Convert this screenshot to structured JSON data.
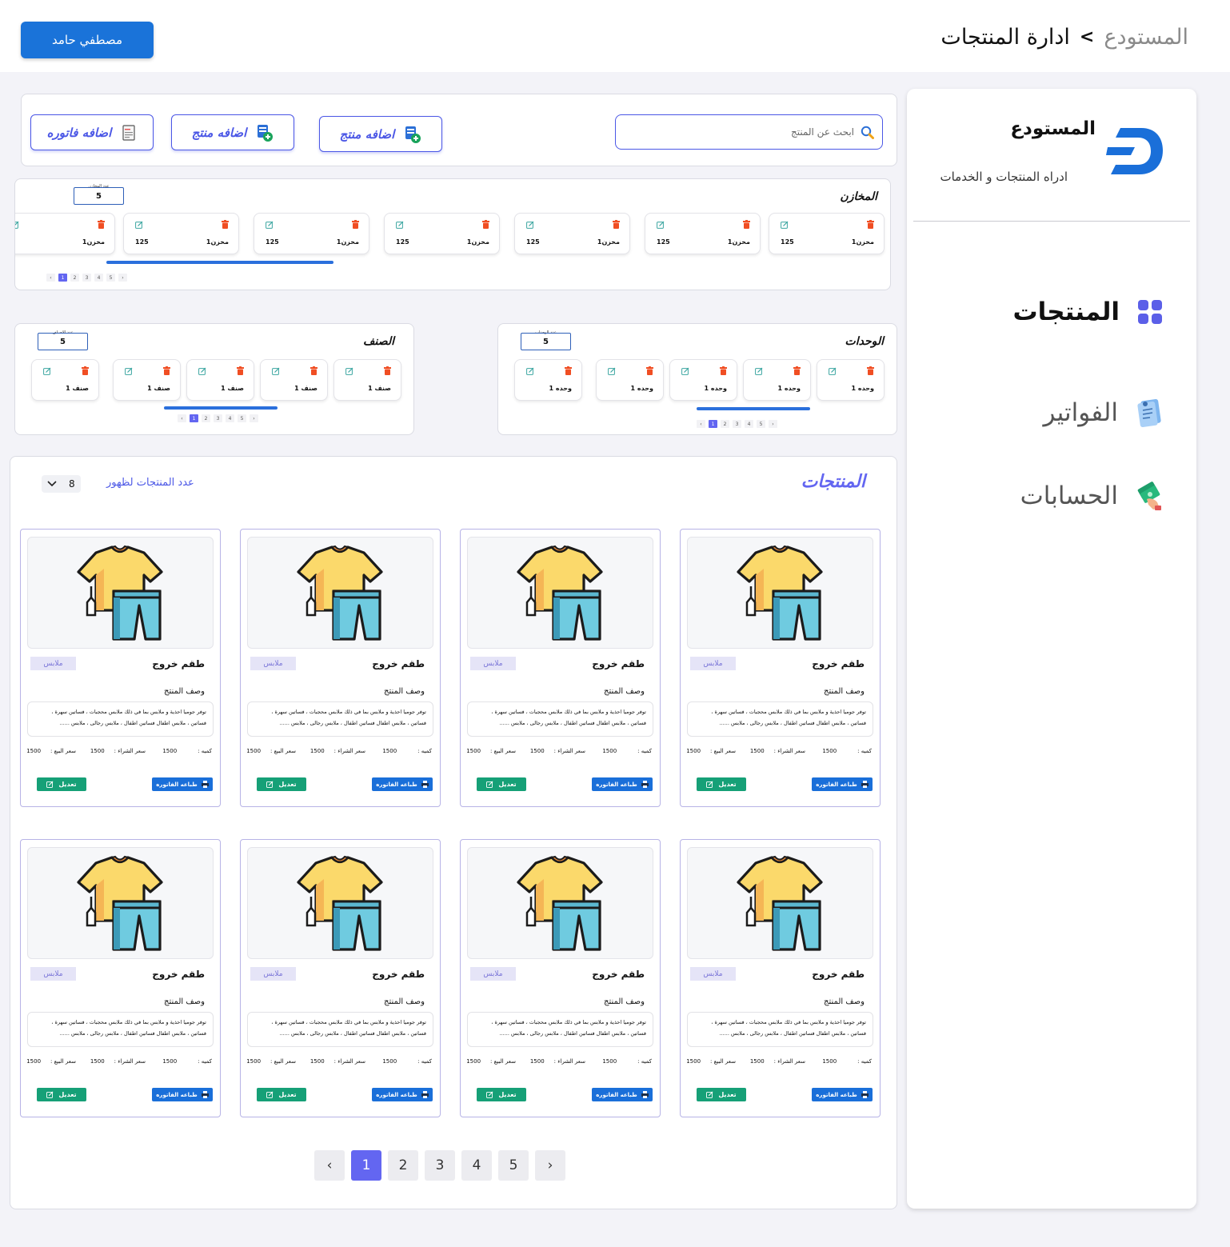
{
  "header": {
    "user_name": "مصطفي حامد",
    "breadcrumb_root": "المستودع",
    "breadcrumb_sep": ">",
    "breadcrumb_current": "ادارة المنتجات"
  },
  "sidebar": {
    "brand_title": "المستودع",
    "brand_subtitle": "ادراه المنتجات و الخدمات",
    "items": [
      {
        "label": "المنتجات",
        "icon": "grid-icon",
        "color": "#111111"
      },
      {
        "label": "الفواتير",
        "icon": "invoice-icon",
        "color": "#555555"
      },
      {
        "label": "الحسابات",
        "icon": "money-icon",
        "color": "#555555"
      }
    ]
  },
  "toolbar": {
    "search_placeholder": "ابحث عن المنتج",
    "buttons": [
      "اضافه منتج",
      "اضافه منتج",
      "اضافه فاتوره"
    ]
  },
  "warehouses": {
    "title": "المخازن",
    "count_label": "عدد المخازن",
    "count": "5",
    "items": [
      {
        "name": "مخزن1",
        "qty": "125"
      },
      {
        "name": "مخزن1",
        "qty": "125"
      },
      {
        "name": "مخزن1",
        "qty": "125"
      },
      {
        "name": "مخزن1",
        "qty": "125"
      },
      {
        "name": "مخزن1",
        "qty": "125"
      },
      {
        "name": "مخزن1",
        "qty": "125"
      },
      {
        "name": "مخزن1",
        "qty": ""
      }
    ],
    "pages": [
      "‹",
      "1",
      "2",
      "3",
      "4",
      "5",
      "›"
    ]
  },
  "units": {
    "title": "الوحدات",
    "count_label": "عدد الوحدات",
    "count": "5",
    "items": [
      "وحده 1",
      "وحده 1",
      "وحده 1",
      "وحده 1",
      "وحده 1"
    ],
    "pages": [
      "‹",
      "1",
      "2",
      "3",
      "4",
      "5",
      "›"
    ]
  },
  "categories": {
    "title": "الصنف",
    "count_label": "عدد الاصناف",
    "count": "5",
    "items": [
      "صنف 1",
      "صنف 1",
      "صنف 1",
      "صنف 1",
      "صنف 1"
    ],
    "pages": [
      "‹",
      "1",
      "2",
      "3",
      "4",
      "5",
      "›"
    ]
  },
  "products": {
    "title": "المنتجات",
    "per_page_label": "عدد المنتجات لظهور",
    "per_page": "8",
    "card": {
      "name": "طقم خروج",
      "tag": "ملابس",
      "desc_label": "وصف المنتج",
      "desc": "توفر جوميا احذية و ملابس بما في ذلك ملابس محجبات ، فساتين سهرة ، فساتين ، ملابس اطفال فساتين اطفال ، ملابس رجالى ، ملابس ......",
      "qty_label": "كميه :",
      "qty": "1500",
      "buy_label": "سعر الشراء :",
      "buy": "1500",
      "sell_label": "سعر البيع :",
      "sell": "1500",
      "print_label": "طباعه الفاتوره",
      "edit_label": "تعديل"
    },
    "count": 8,
    "pages": [
      "‹",
      "1",
      "2",
      "3",
      "4",
      "5",
      "›"
    ]
  },
  "colors": {
    "accent": "#6366f1",
    "primary_blue": "#1a73d9",
    "edit_green": "#16a077",
    "delete_red": "#f04e23"
  }
}
